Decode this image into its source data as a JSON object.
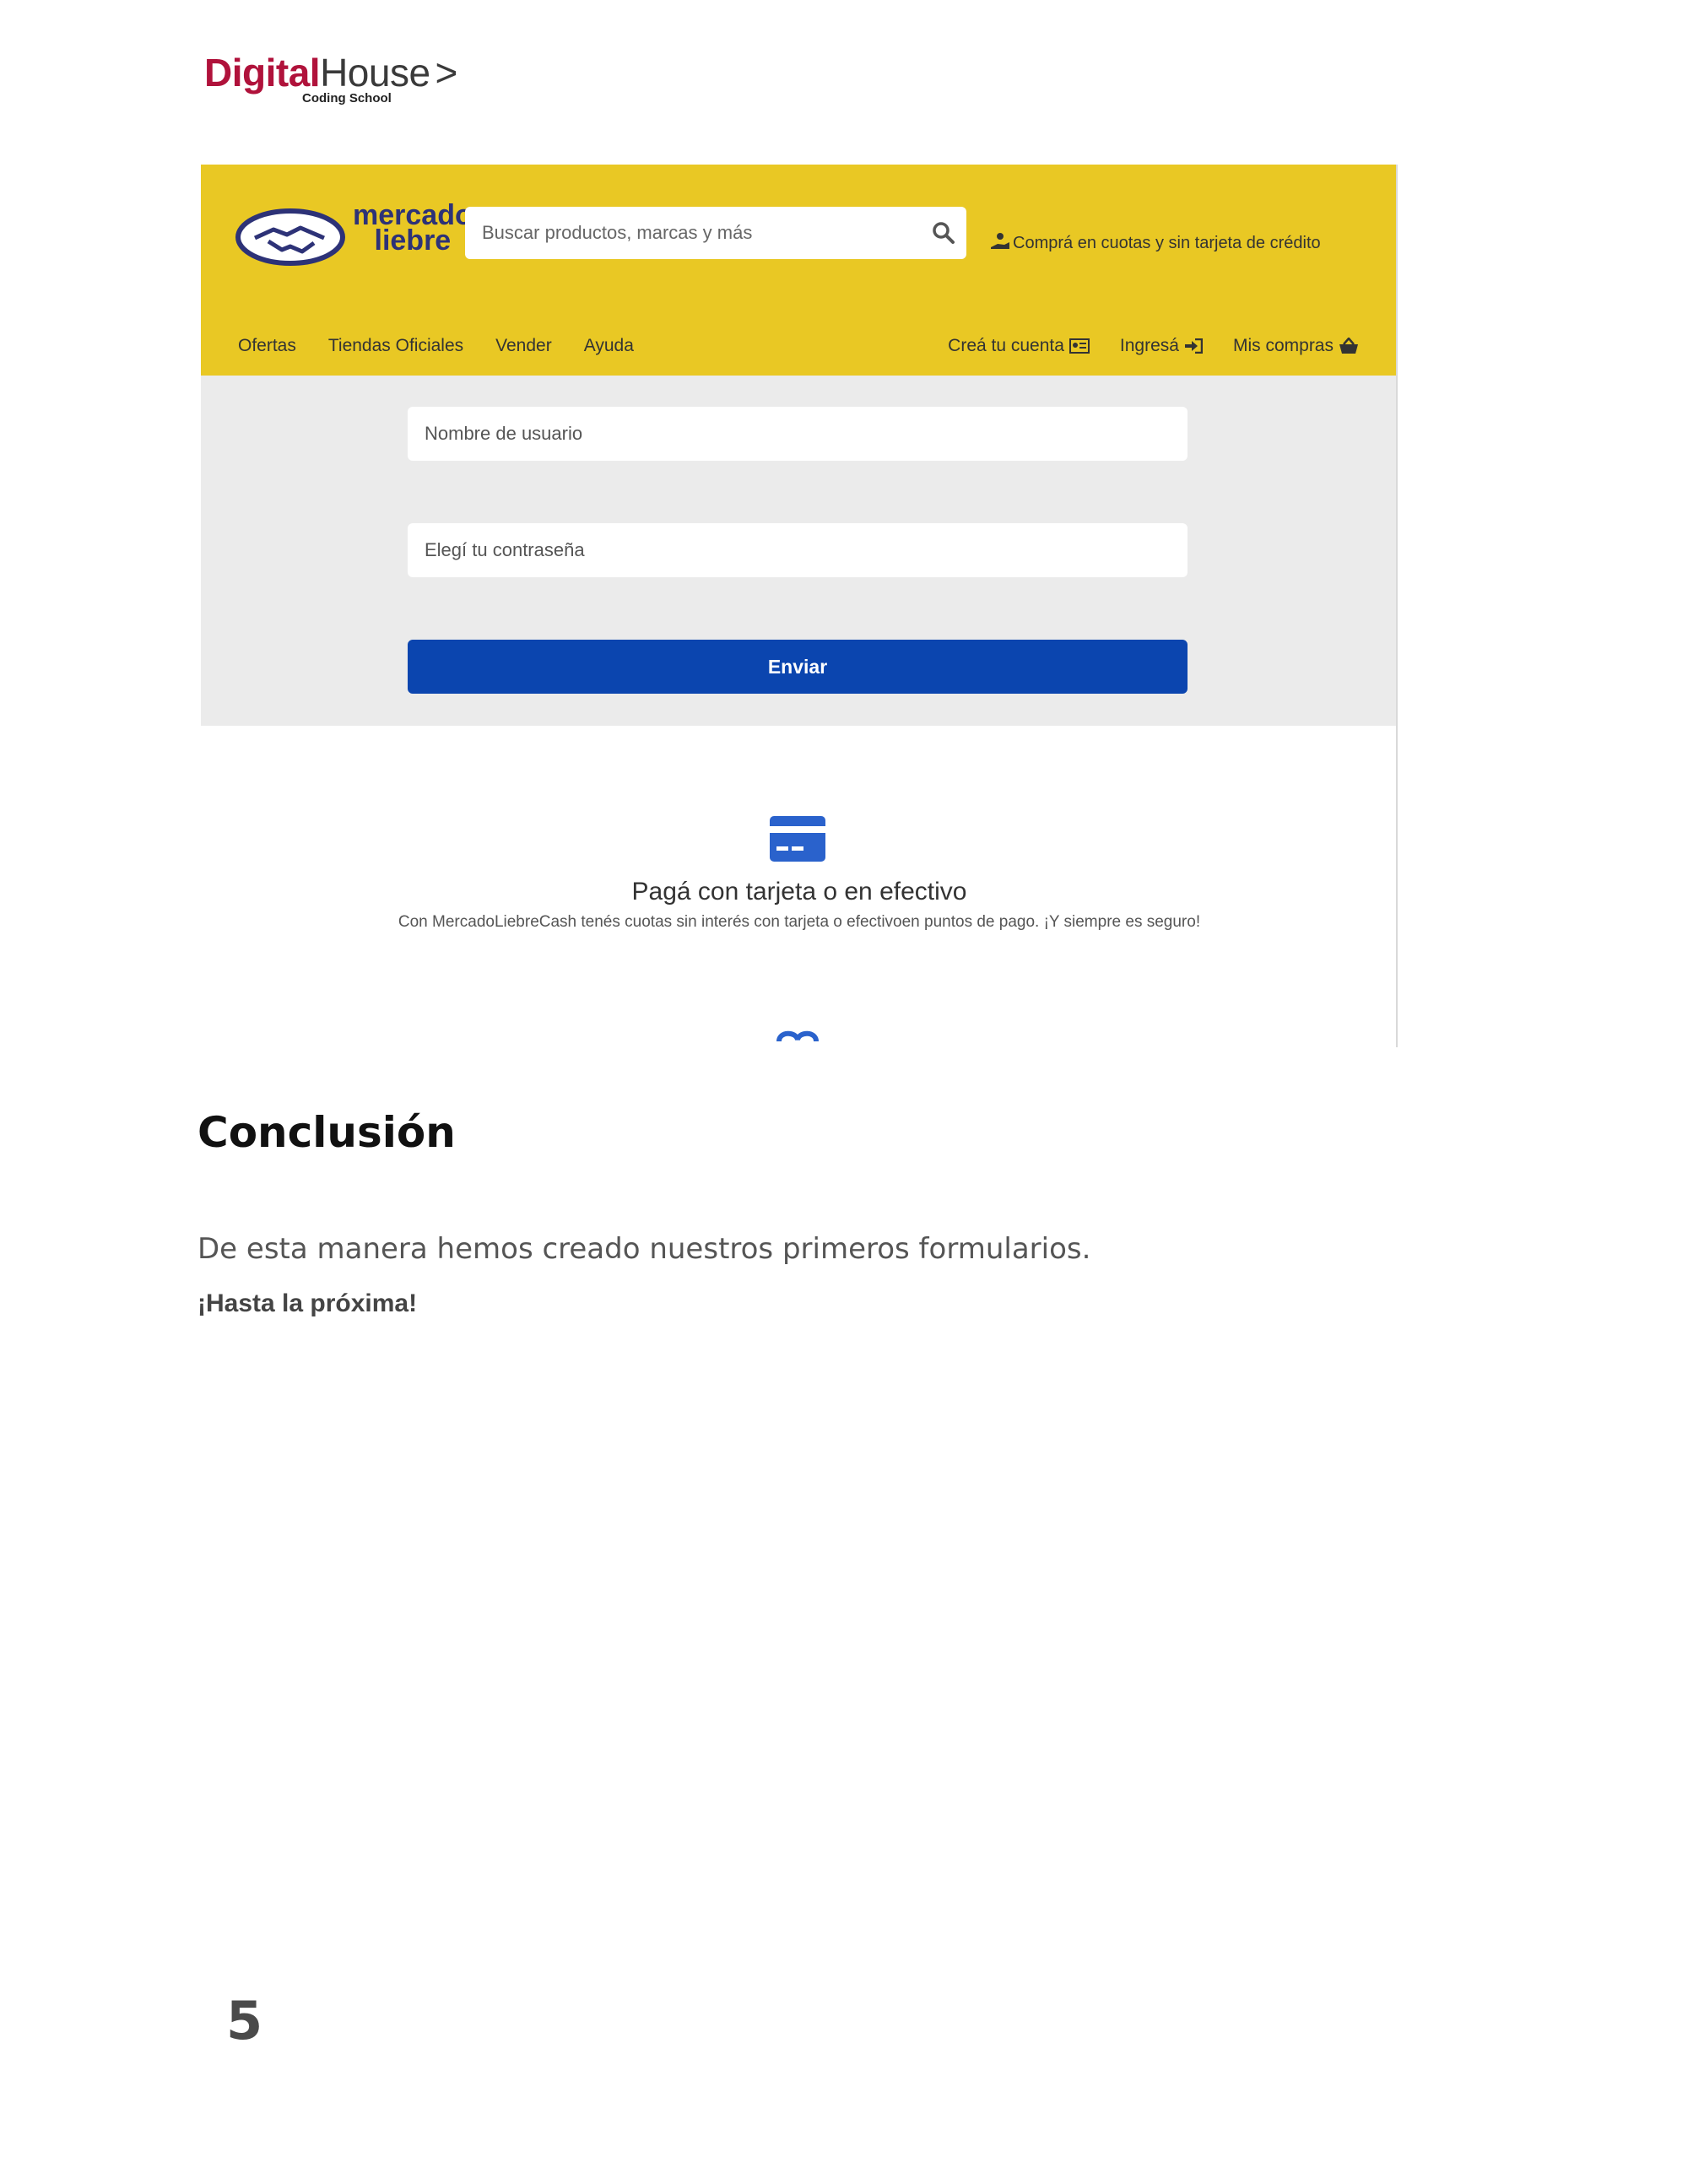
{
  "brand": {
    "digital": "Digital",
    "house": "House",
    "chevron": ">",
    "subtitle": "Coding School",
    "primary_color": "#b0123b"
  },
  "screenshot": {
    "logo": {
      "line1": "mercado",
      "line2": "liebre",
      "icon": "handshake-logo-icon"
    },
    "search": {
      "placeholder": "Buscar productos, marcas y más",
      "icon": "search-icon"
    },
    "promo": {
      "text": "Comprá en cuotas y sin tarjeta de crédito",
      "icon": "hand-coin-icon"
    },
    "nav_left": [
      "Ofertas",
      "Tiendas Oficiales",
      "Vender",
      "Ayuda"
    ],
    "nav_right": [
      {
        "label": "Creá tu cuenta",
        "icon": "id-card-icon"
      },
      {
        "label": "Ingresá",
        "icon": "sign-in-icon"
      },
      {
        "label": "Mis compras",
        "icon": "basket-icon"
      }
    ],
    "form": {
      "username_placeholder": "Nombre de usuario",
      "password_placeholder": "Elegí tu contraseña",
      "submit_label": "Enviar"
    },
    "payment": {
      "title": "Pagá con tarjeta o en efectivo",
      "description": "Con MercadoLiebreCash tenés cuotas sin interés con tarjeta o efectivoen puntos de pago. ¡Y siempre es seguro!",
      "icon": "credit-card-icon"
    },
    "colors": {
      "header_yellow": "#e9c824",
      "form_background": "#ebebeb",
      "button_blue": "#0b45af",
      "logo_navy": "#2d3277"
    }
  },
  "conclusion": {
    "heading": "Conclusión",
    "paragraph": "De esta manera hemos creado nuestros primeros formularios.",
    "signoff": "¡Hasta la próxima!"
  },
  "page": {
    "number": "5"
  }
}
